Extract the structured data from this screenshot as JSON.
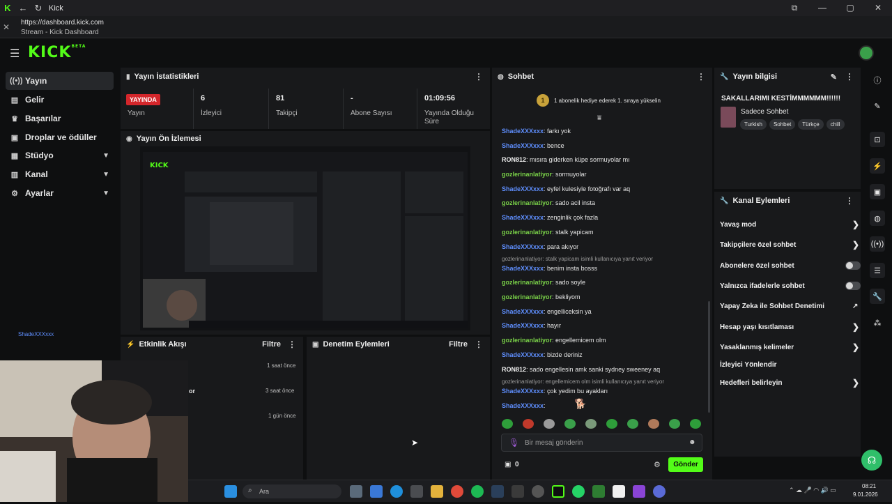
{
  "browser": {
    "tab_title": "Kick",
    "url": "https://dashboard.kick.com",
    "page_title": "Stream - Kick Dashboard"
  },
  "header": {
    "logo": "KICK",
    "logo_sup": "BETA"
  },
  "sidebar": {
    "items": [
      {
        "label": "Yayın",
        "icon": "broadcast-icon"
      },
      {
        "label": "Gelir",
        "icon": "revenue-icon"
      },
      {
        "label": "Başarılar",
        "icon": "trophy-icon"
      },
      {
        "label": "Droplar ve ödüller",
        "icon": "gift-icon"
      },
      {
        "label": "Stüdyo",
        "icon": "studio-icon"
      },
      {
        "label": "Kanal",
        "icon": "channel-icon"
      },
      {
        "label": "Ayarlar",
        "icon": "gear-icon"
      }
    ],
    "user_tag": "ShadeXXXxxx"
  },
  "stats": {
    "title": "Yayın İstatistikleri",
    "live_badge": "YAYINDA",
    "live_label": "Yayın",
    "viewers_value": "6",
    "viewers_label": "İzleyici",
    "followers_value": "81",
    "followers_label": "Takipçi",
    "subs_value": "-",
    "subs_label": "Abone Sayısı",
    "uptime_value": "01:09:56",
    "uptime_label": "Yayında Olduğu Süre"
  },
  "preview": {
    "title": "Yayın Ön İzlemesi"
  },
  "activity": {
    "title": "Etkinlik Akışı",
    "filter": "Filtre",
    "rows": [
      {
        "text": "",
        "time": "1 saat önce"
      },
      {
        "text": "or",
        "time": "3 saat önce"
      },
      {
        "text": "",
        "time": "1 gün önce"
      }
    ]
  },
  "moderation": {
    "title": "Denetim Eylemleri",
    "filter": "Filtre"
  },
  "chat": {
    "title": "Sohbet",
    "gift_banner": "1 abonelik hediye ederek 1. sıraya yükselin",
    "gift_rank": "1",
    "messages": [
      {
        "user": "ShadeXXXxxx",
        "color": "blue",
        "text": ": farkı yok"
      },
      {
        "user": "ShadeXXXxxx",
        "color": "blue",
        "text": ": bence"
      },
      {
        "user": "RON812",
        "color": "white",
        "text": ": mısıra giderken küpe sormuyolar mı"
      },
      {
        "user": "gozlerinanlatiyor",
        "color": "green",
        "text": ": sormuyolar"
      },
      {
        "user": "ShadeXXXxxx",
        "color": "blue",
        "text": ": eyfel kulesiyle fotoğrafı var aq"
      },
      {
        "user": "gozlerinanlatiyor",
        "color": "green",
        "text": ": sado acil insta"
      },
      {
        "user": "ShadeXXXxxx",
        "color": "blue",
        "text": ": zenginlik çok fazla"
      },
      {
        "user": "gozlerinanlatiyor",
        "color": "green",
        "text": ": stalk yapicam"
      },
      {
        "user": "ShadeXXXxxx",
        "color": "blue",
        "text": ": para akıyor"
      },
      {
        "user": "ShadeXXXxxx",
        "color": "blue",
        "text": ": benim insta bosss"
      },
      {
        "user": "gozlerinanlatiyor",
        "color": "green",
        "text": ": sado soyle"
      },
      {
        "user": "gozlerinanlatiyor",
        "color": "green",
        "text": ": bekliyom"
      },
      {
        "user": "ShadeXXXxxx",
        "color": "blue",
        "text": ": engelliceksin ya"
      },
      {
        "user": "ShadeXXXxxx",
        "color": "blue",
        "text": ": hayır"
      },
      {
        "user": "gozlerinanlatiyor",
        "color": "green",
        "text": ": engellemicem olm"
      },
      {
        "user": "ShadeXXXxxx",
        "color": "blue",
        "text": ": bizde deriniz"
      },
      {
        "user": "RON812",
        "color": "white",
        "text": ": sado engellesin amk sanki sydney sweeney aq"
      },
      {
        "user": "ShadeXXXxxx",
        "color": "blue",
        "text": ": çok yedim bu ayakları"
      },
      {
        "user": "ShadeXXXxxx",
        "color": "blue",
        "text": ":"
      }
    ],
    "replies": [
      "gozlerinanlatiyor: stalk yapicam isimli kullanıcıya yanıt veriyor",
      "gozlerinanlatiyor: engellemicem olm isimli kullanıcıya yanıt veriyor"
    ],
    "input_placeholder": "Bir mesaj gönderin",
    "count": "0",
    "send_label": "Gönder"
  },
  "stream_info": {
    "title": "Yayın bilgisi",
    "stream_title": "SAKALLARIMI KESTİMMMMMM!!!!!!",
    "category": "Sadece Sohbet",
    "tags": [
      "Turkish",
      "Sohbet",
      "Türkçe",
      "chill"
    ]
  },
  "channel_actions": {
    "title": "Kanal Eylemleri",
    "items": [
      {
        "label": "Yavaş mod",
        "control": "chevron"
      },
      {
        "label": "Takipçilere özel sohbet",
        "control": "chevron"
      },
      {
        "label": "Abonelere özel sohbet",
        "control": "toggle"
      },
      {
        "label": "Yalnızca ifadelerle sohbet",
        "control": "toggle"
      },
      {
        "label": "Yapay Zeka ile Sohbet Denetimi",
        "control": "external"
      },
      {
        "label": "Hesap yaşı kısıtlaması",
        "control": "chevron"
      },
      {
        "label": "Yasaklanmış kelimeler",
        "control": "chevron"
      },
      {
        "label": "İzleyici Yönlendir",
        "control": "none"
      },
      {
        "label": "Hedefleri belirleyin",
        "control": "chevron"
      }
    ]
  },
  "taskbar": {
    "search_placeholder": "Ara",
    "time": "08:21",
    "date": "9.01.2026"
  },
  "colors": {
    "kick_green": "#53fc18",
    "live_red": "#d4262b",
    "user_blue": "#5f8fff",
    "user_green": "#7ad248",
    "send_green": "#53fc18"
  }
}
